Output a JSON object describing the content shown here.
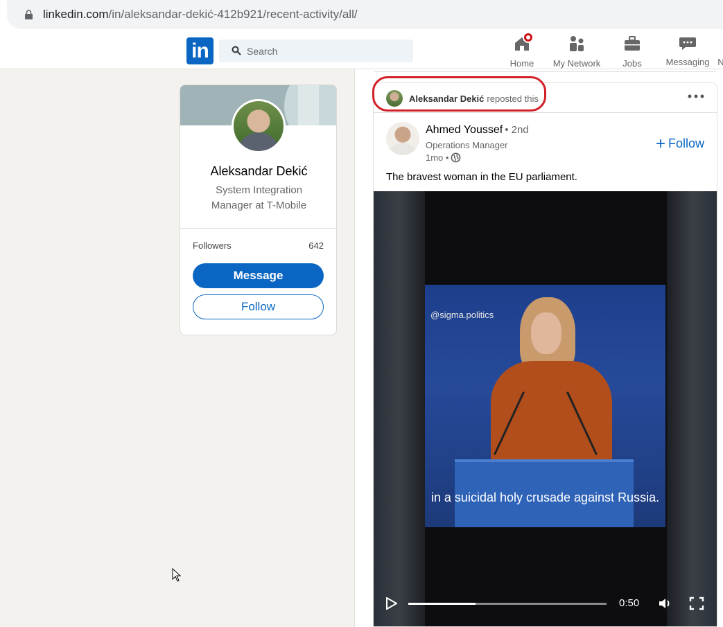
{
  "browser": {
    "url_domain": "linkedin.com",
    "url_path": "/in/aleksandar-dekić-412b921/recent-activity/all/"
  },
  "nav": {
    "logo_text": "in",
    "search_placeholder": "Search",
    "items": [
      {
        "label": "Home",
        "icon": "home-icon"
      },
      {
        "label": "My Network",
        "icon": "network-icon"
      },
      {
        "label": "Jobs",
        "icon": "briefcase-icon"
      },
      {
        "label": "Messaging",
        "icon": "messaging-icon"
      },
      {
        "label": "N",
        "icon": "notifications-icon"
      }
    ]
  },
  "profile": {
    "name": "Aleksandar Dekić",
    "headline": "System Integration Manager at T-Mobile",
    "followers_label": "Followers",
    "followers_count": "642",
    "message_label": "Message",
    "follow_label": "Follow"
  },
  "post": {
    "reposter_name": "Aleksandar Dekić",
    "repost_action": "reposted this",
    "author_name": "Ahmed Youssef",
    "author_degree": "• 2nd",
    "author_title": "Operations Manager",
    "author_time": "1mo •",
    "follow_label": "Follow",
    "follow_plus": "+",
    "text": "The bravest woman in the EU parliament.",
    "video": {
      "watermark": "@sigma.politics",
      "subtitle": "in a suicidal holy crusade against Russia.",
      "time": "0:50",
      "progress": 0.34
    }
  },
  "colors": {
    "brand": "#0a66c2",
    "highlight": "#d21f28",
    "badge": "#cc1016"
  }
}
